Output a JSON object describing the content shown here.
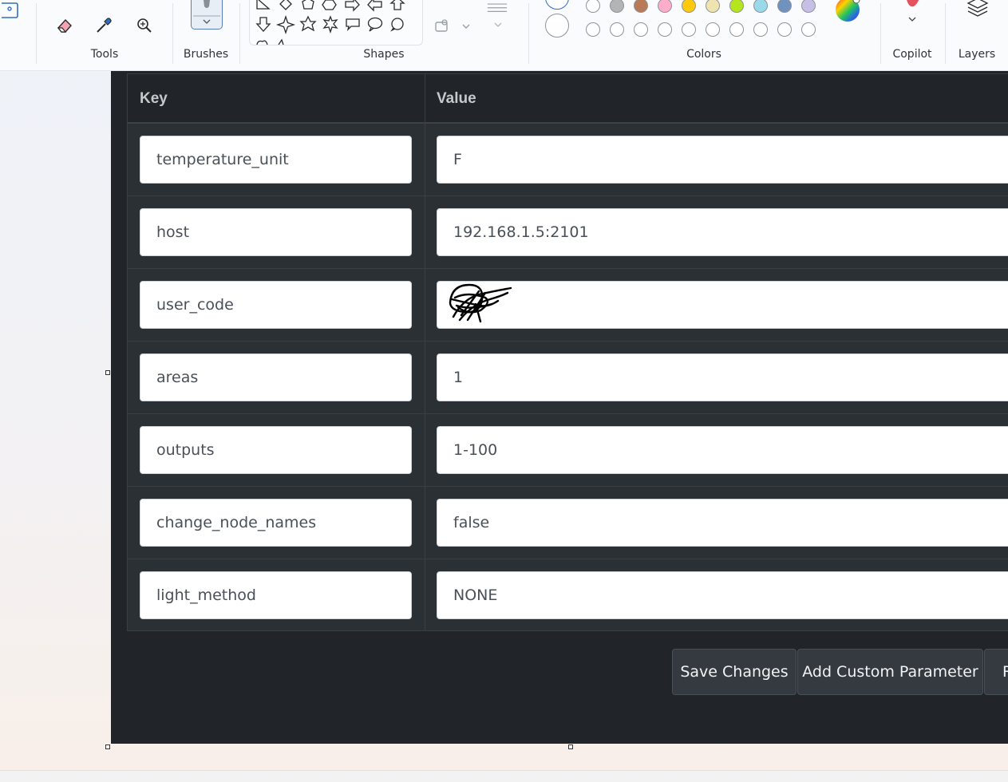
{
  "ribbon": {
    "groups": {
      "tools": "Tools",
      "brushes": "Brushes",
      "shapes": "Shapes",
      "colors": "Colors",
      "copilot": "Copilot",
      "layers": "Layers"
    },
    "tool_icons": [
      "eraser-icon",
      "color-picker-icon",
      "magnifier-icon"
    ],
    "palette_top": [
      "#ffffff",
      "#b4b4b4",
      "#b97a57",
      "#ffaec9",
      "#ffc90e",
      "#efe4b0",
      "#b5e61d",
      "#99d9ea",
      "#7092be",
      "#c8bfe7"
    ],
    "palette_bottom_count": 10
  },
  "table": {
    "headers": {
      "key": "Key",
      "value": "Value"
    },
    "rows": [
      {
        "key": "temperature_unit",
        "value": "F"
      },
      {
        "key": "host",
        "value": "192.168.1.5:2101"
      },
      {
        "key": "user_code",
        "value": ""
      },
      {
        "key": "areas",
        "value": "1"
      },
      {
        "key": "outputs",
        "value": "1-100"
      },
      {
        "key": "change_node_names",
        "value": "false"
      },
      {
        "key": "light_method",
        "value": "NONE"
      }
    ]
  },
  "buttons": {
    "save": "Save Changes",
    "add": "Add Custom Parameter",
    "third_partial": "R"
  }
}
